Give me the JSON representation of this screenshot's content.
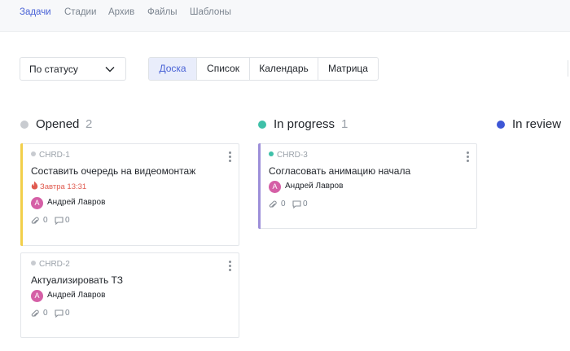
{
  "topnav": {
    "tabs": [
      {
        "label": "Задачи",
        "active": true
      },
      {
        "label": "Стадии"
      },
      {
        "label": "Архив"
      },
      {
        "label": "Файлы"
      },
      {
        "label": "Шаблоны"
      }
    ]
  },
  "filter": {
    "value": "По статусу"
  },
  "views": [
    {
      "label": "Доска",
      "active": true
    },
    {
      "label": "Список"
    },
    {
      "label": "Календарь"
    },
    {
      "label": "Матрица"
    }
  ],
  "columns": [
    {
      "title": "Opened",
      "count": "2",
      "color": "#c8cbd0",
      "cards": [
        {
          "key": "CHRD-1",
          "name": "Составить очередь на видеомонтаж",
          "due": "Завтра 13:31",
          "assignee_initial": "А",
          "assignee": "Андрей Лавров",
          "attachments": "0",
          "comments": "0",
          "accent": "#f2cf4a"
        },
        {
          "key": "CHRD-2",
          "name": "Актуализировать ТЗ",
          "assignee_initial": "А",
          "assignee": "Андрей Лавров",
          "attachments": "0",
          "comments": "0"
        }
      ]
    },
    {
      "title": "In progress",
      "count": "1",
      "color": "#3fc0a8",
      "cards": [
        {
          "key": "CHRD-3",
          "name": "Согласовать анимацию начала",
          "assignee_initial": "А",
          "assignee": "Андрей Лавров",
          "attachments": "0",
          "comments": "0",
          "accent": "#9d8fd9"
        }
      ]
    },
    {
      "title": "In review",
      "color": "#3d56d6"
    }
  ],
  "colors": {
    "accent": "#4a63d6",
    "avatar": "#d55fa6",
    "due": "#e05a4f"
  },
  "icons": {
    "filter_chevron": "chevron-down-icon",
    "due": "fire-icon",
    "attachments": "paperclip-icon",
    "comments": "comment-icon",
    "card_menu": "kebab-menu-icon"
  }
}
